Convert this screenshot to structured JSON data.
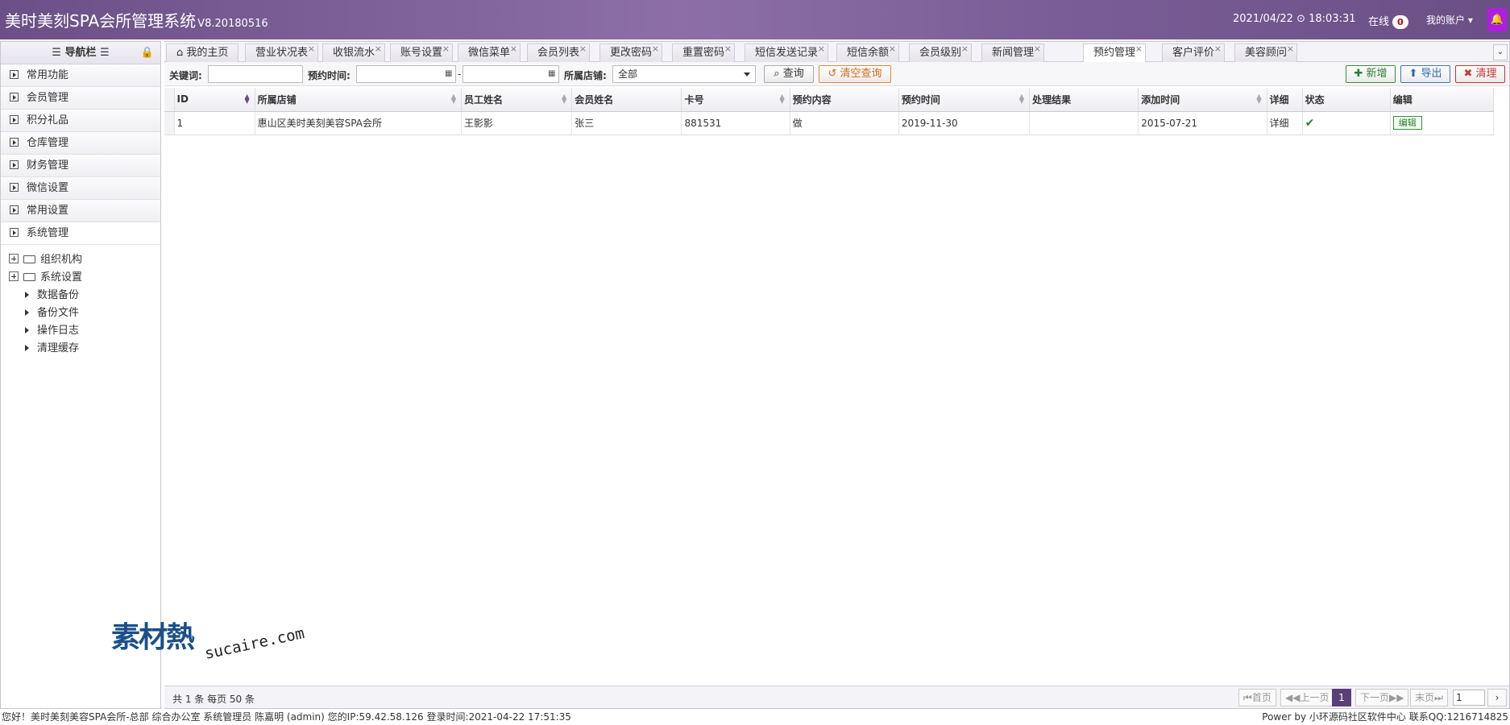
{
  "header": {
    "title": "美时美刻SPA会所管理系统",
    "version": "V8.20180516",
    "date": "2021/04/22",
    "time": "18:03:31",
    "online_label": "在线",
    "online_count": "0",
    "account_label": "我的账户"
  },
  "sidebar": {
    "title": "导航栏",
    "menu": [
      {
        "label": "常用功能"
      },
      {
        "label": "会员管理"
      },
      {
        "label": "积分礼品"
      },
      {
        "label": "仓库管理"
      },
      {
        "label": "财务管理"
      },
      {
        "label": "微信设置"
      },
      {
        "label": "常用设置"
      },
      {
        "label": "系统管理"
      }
    ],
    "tree": {
      "nodes": [
        "组织机构",
        "系统设置"
      ],
      "children": [
        "数据备份",
        "备份文件",
        "操作日志",
        "清理缓存"
      ]
    }
  },
  "tabs": [
    "我的主页",
    "营业状况表",
    "收银流水",
    "账号设置",
    "微信菜单",
    "会员列表",
    "更改密码",
    "重置密码",
    "短信发送记录",
    "短信余额",
    "会员级别",
    "新闻管理",
    "预约管理",
    "客户评价",
    "美容顾问"
  ],
  "active_tab": "预约管理",
  "toolbar": {
    "keyword_label": "关键词:",
    "keyword_value": "",
    "date_label": "预约时间:",
    "date_sep": "-",
    "store_label": "所属店铺:",
    "store_value": "全部",
    "search_label": "查询",
    "clear_label": "清空查询",
    "add_label": "新增",
    "export_label": "导出",
    "wipe_label": "清理"
  },
  "table": {
    "columns": [
      "ID",
      "所属店铺",
      "员工姓名",
      "会员姓名",
      "卡号",
      "预约内容",
      "预约时间",
      "处理结果",
      "添加时间",
      "详细",
      "状态",
      "编辑"
    ],
    "rows": [
      {
        "id": "1",
        "store": "惠山区美时美刻美容SPA会所",
        "staff": "王影影",
        "member": "张三",
        "card": "881531",
        "content": "做",
        "booking_time": "2019-11-30",
        "result": "",
        "added": "2015-07-21",
        "detail": "详细",
        "edit": "编辑"
      }
    ]
  },
  "pager": {
    "info": "共 1 条 每页 50 条",
    "first": "首页",
    "prev": "上一页",
    "current": "1",
    "next": "下一页",
    "last": "末页",
    "page_input": "1"
  },
  "footer": {
    "left": "您好！美时美刻美容SPA会所-总部 综合办公室 系统管理员 陈嘉明 (admin) 您的IP:59.42.58.126 登录时间:2021-04-22 17:51:35",
    "right": "Power by 小环源码社区软件中心 联系QQ:1216714825"
  },
  "watermark": {
    "cn": "素材熱",
    "en": "sucaire.com"
  }
}
